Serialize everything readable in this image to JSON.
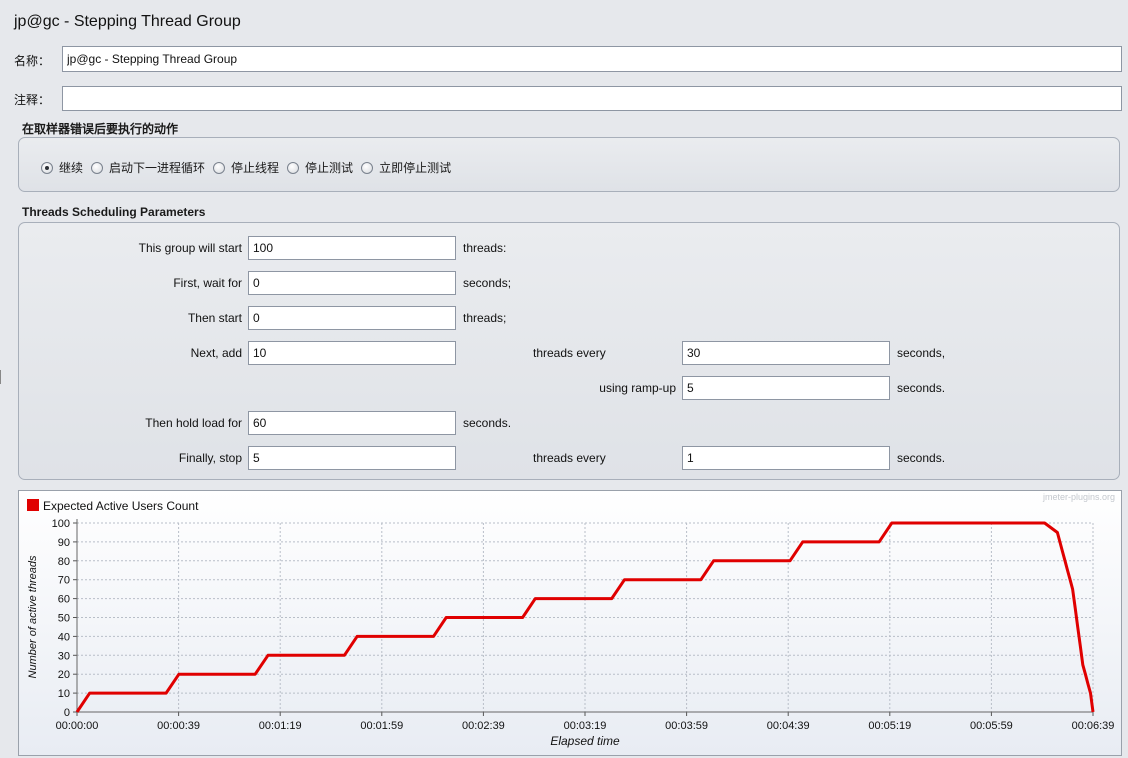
{
  "window": {
    "title": "jp@gc - Stepping Thread Group"
  },
  "form": {
    "name_label": "名称：",
    "name_value": "jp@gc - Stepping Thread Group",
    "comment_label": "注释：",
    "comment_value": ""
  },
  "sampler_error": {
    "title": "在取样器错误后要执行的动作",
    "options": [
      {
        "label": "继续",
        "checked": true
      },
      {
        "label": "启动下一进程循环",
        "checked": false
      },
      {
        "label": "停止线程",
        "checked": false
      },
      {
        "label": "停止测试",
        "checked": false
      },
      {
        "label": "立即停止测试",
        "checked": false
      }
    ]
  },
  "scheduling": {
    "title": "Threads Scheduling Parameters",
    "start_label": "This group will start",
    "start_value": "100",
    "start_unit": "threads:",
    "wait_label": "First, wait for",
    "wait_value": "0",
    "wait_unit": "seconds;",
    "then_label": "Then start",
    "then_value": "0",
    "then_unit": "threads;",
    "next_label": "Next, add",
    "next_value": "10",
    "next_mid": "threads every",
    "next_every": "30",
    "next_unit": "seconds,",
    "ramp_label": "using ramp-up",
    "ramp_value": "5",
    "ramp_unit": "seconds.",
    "hold_label": "Then hold load for",
    "hold_value": "60",
    "hold_unit": "seconds.",
    "stop_label": "Finally, stop",
    "stop_value": "5",
    "stop_mid": "threads every",
    "stop_every": "1",
    "stop_unit": "seconds."
  },
  "chart": {
    "watermark": "jmeter-plugins.org",
    "line_color": "#e00000",
    "grid_color": "#b8bec8"
  },
  "chart_data": {
    "type": "line",
    "legend": "Expected Active Users Count",
    "xlabel": "Elapsed time",
    "ylabel": "Number of active threads",
    "ylim": [
      0,
      100
    ],
    "yticks": [
      0,
      10,
      20,
      30,
      40,
      50,
      60,
      70,
      80,
      90,
      100
    ],
    "xticks": [
      "00:00:00",
      "00:00:39",
      "00:01:19",
      "00:01:59",
      "00:02:39",
      "00:03:19",
      "00:03:59",
      "00:04:39",
      "00:05:19",
      "00:05:59",
      "00:06:39"
    ],
    "xlim_seconds": [
      0,
      399
    ],
    "grid": true,
    "legend_position": "top-left",
    "series": [
      {
        "name": "Expected Active Users Count",
        "x_seconds": [
          0,
          5,
          35,
          40,
          70,
          75,
          105,
          110,
          140,
          145,
          175,
          180,
          210,
          215,
          245,
          250,
          280,
          285,
          315,
          320,
          380,
          385,
          386,
          387,
          388,
          389,
          390,
          391,
          392,
          393,
          394,
          395,
          396,
          397,
          398,
          399
        ],
        "y": [
          0,
          10,
          10,
          20,
          20,
          30,
          30,
          40,
          40,
          50,
          50,
          60,
          60,
          70,
          70,
          80,
          80,
          90,
          90,
          100,
          100,
          95,
          90,
          85,
          80,
          75,
          70,
          65,
          55,
          45,
          35,
          25,
          20,
          15,
          10,
          0
        ]
      }
    ]
  }
}
